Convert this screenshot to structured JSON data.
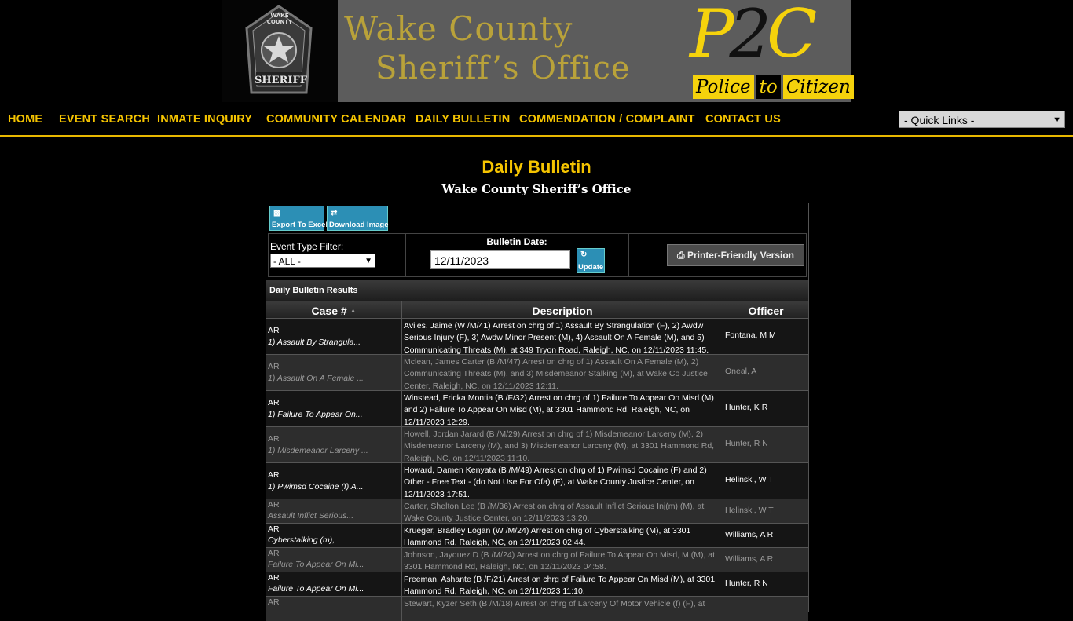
{
  "banner": {
    "agency_line1": "Wake County",
    "agency_line2": "Sheriff’s Office",
    "badge_top": "WAKE COUNTY",
    "badge_bottom": "SHERIFF",
    "p2c_p": "P",
    "p2c_2": "2",
    "p2c_c": "C",
    "tagline_police": "Police",
    "tagline_to": "to",
    "tagline_citizen": "Citizen"
  },
  "nav": {
    "items": [
      {
        "label": "HOME"
      },
      {
        "label": "EVENT SEARCH"
      },
      {
        "label": "INMATE INQUIRY"
      },
      {
        "label": "COMMUNITY CALENDAR"
      },
      {
        "label": "DAILY BULLETIN"
      },
      {
        "label": "COMMENDATION / COMPLAINT"
      },
      {
        "label": "CONTACT US"
      }
    ],
    "quick_links": "- Quick Links -"
  },
  "page": {
    "title": "Daily Bulletin",
    "subtitle": "Wake County Sheriff’s Office"
  },
  "toolbar": {
    "export_label": "Export To Excel",
    "download_label": "Download Image"
  },
  "filters": {
    "event_type_label": "Event Type Filter:",
    "event_type_value": "- ALL -",
    "bulletin_date_label": "Bulletin Date:",
    "bulletin_date_value": "12/11/2023",
    "update_label": "Update",
    "printer_label": "Printer-Friendly Version"
  },
  "results": {
    "header": "Daily Bulletin Results",
    "columns": {
      "case": "Case #",
      "description": "Description",
      "officer": "Officer"
    },
    "rows": [
      {
        "code": "AR",
        "charge": "1) Assault By Strangula...",
        "description": "Aviles, Jaime (W /M/41) Arrest on chrg of 1) Assault By Strangulation (F), 2) Awdw Serious Injury (F), 3) Awdw Minor Present (M), 4) Assault On A Female (M), and 5) Communicating Threats (M), at 349 Tryon Road, Raleigh, NC, on 12/11/2023 11:45.",
        "officer": "Fontana, M M"
      },
      {
        "code": "AR",
        "charge": "1) Assault On A Female ...",
        "description": "Mclean, James Carter (B /M/47) Arrest on chrg of 1) Assault On A Female (M), 2) Communicating Threats (M), and 3) Misdemeanor Stalking (M), at Wake Co Justice Center, Raleigh, NC, on 12/11/2023 12:11.",
        "officer": "Oneal, A"
      },
      {
        "code": "AR",
        "charge": "1) Failure To Appear On...",
        "description": "Winstead, Ericka Montia (B /F/32) Arrest on chrg of 1) Failure To Appear On Misd (M) and 2) Failure To Appear On Misd (M), at 3301 Hammond Rd, Raleigh, NC, on 12/11/2023 12:29.",
        "officer": "Hunter, K R"
      },
      {
        "code": "AR",
        "charge": "1) Misdemeanor Larceny ...",
        "description": "Howell, Jordan Jarard (B /M/29) Arrest on chrg of 1) Misdemeanor Larceny (M), 2) Misdemeanor Larceny (M), and 3) Misdemeanor Larceny (M), at 3301 Hammond Rd, Raleigh, NC, on 12/11/2023 11:10.",
        "officer": "Hunter, R N"
      },
      {
        "code": "AR",
        "charge": "1) Pwimsd Cocaine (f) A...",
        "description": "Howard, Damen Kenyata (B /M/49) Arrest on chrg of 1) Pwimsd Cocaine (F) and 2) Other - Free Text - (do Not Use For Ofa) (F), at Wake County Justice Center, on 12/11/2023 17:51.",
        "officer": "Helinski, W T"
      },
      {
        "code": "AR",
        "charge": "Assault Inflict Serious...",
        "description": "Carter, Shelton Lee (B /M/36) Arrest on chrg of Assault Inflict Serious Inj(m) (M), at Wake County Justice Center, on 12/11/2023 13:20.",
        "officer": "Helinski, W T"
      },
      {
        "code": "AR",
        "charge": "Cyberstalking (m),",
        "description": "Krueger, Bradley Logan (W /M/24) Arrest on chrg of Cyberstalking (M), at 3301 Hammond Rd, Raleigh, NC, on 12/11/2023 02:44.",
        "officer": "Williams, A R"
      },
      {
        "code": "AR",
        "charge": "Failure To Appear On Mi...",
        "description": "Johnson, Jayquez D (B /M/24) Arrest on chrg of Failure To Appear On Misd, M (M), at 3301 Hammond Rd, Raleigh, NC, on 12/11/2023 04:58.",
        "officer": "Williams, A R"
      },
      {
        "code": "AR",
        "charge": "Failure To Appear On Mi...",
        "description": "Freeman, Ashante (B /F/21) Arrest on chrg of Failure To Appear On Misd (M), at 3301 Hammond Rd, Raleigh, NC, on 12/11/2023 11:10.",
        "officer": "Hunter, R N"
      },
      {
        "code": "AR",
        "charge": "",
        "description": "Stewart, Kyzer Seth (B /M/18) Arrest on chrg of Larceny Of Motor Vehicle (f) (F), at",
        "officer": ""
      }
    ]
  },
  "colors": {
    "accent": "#f5c400",
    "button": "#2c8fb5",
    "background": "#000000"
  }
}
